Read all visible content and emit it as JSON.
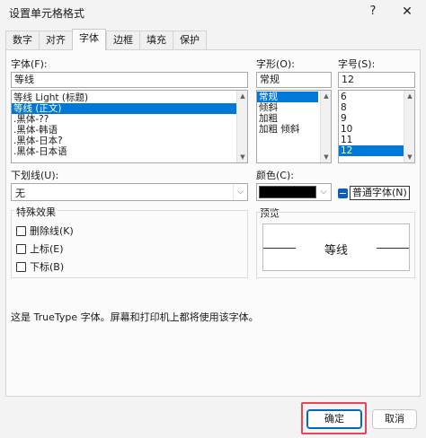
{
  "window": {
    "title": "设置单元格格式",
    "help_label": "?",
    "close_label": "✕"
  },
  "tabs": [
    {
      "label": "数字"
    },
    {
      "label": "对齐"
    },
    {
      "label": "字体",
      "active": true
    },
    {
      "label": "边框"
    },
    {
      "label": "填充"
    },
    {
      "label": "保护"
    }
  ],
  "font": {
    "label": "字体(F):",
    "value": "等线",
    "options": [
      "等线 Light (标题)",
      "等线 (正文)",
      ".黑体-??",
      ".黑体-韩语",
      ".黑体-日本?",
      ".黑体-日本语"
    ],
    "selected_index": 1
  },
  "style": {
    "label": "字形(O):",
    "value": "常规",
    "options": [
      "常规",
      "倾斜",
      "加粗",
      "加粗 倾斜"
    ],
    "selected_index": 0
  },
  "size": {
    "label": "字号(S):",
    "value": "12",
    "options": [
      "6",
      "8",
      "9",
      "10",
      "11",
      "12"
    ],
    "selected_index": 5
  },
  "underline": {
    "label": "下划线(U):",
    "value": "无"
  },
  "color": {
    "label": "颜色(C):",
    "value_hex": "#000000",
    "normal_font_label": "普通字体(N)"
  },
  "effects": {
    "title": "特殊效果",
    "strikethrough": "删除线(K)",
    "superscript": "上标(E)",
    "subscript": "下标(B)"
  },
  "preview": {
    "title": "预览",
    "sample": "等线"
  },
  "info_text": "这是 TrueType 字体。屏幕和打印机上都将使用该字体。",
  "buttons": {
    "ok": "确定",
    "cancel": "取消"
  },
  "colors": {
    "accent": "#0078d7",
    "highlight": "#e8455a"
  }
}
